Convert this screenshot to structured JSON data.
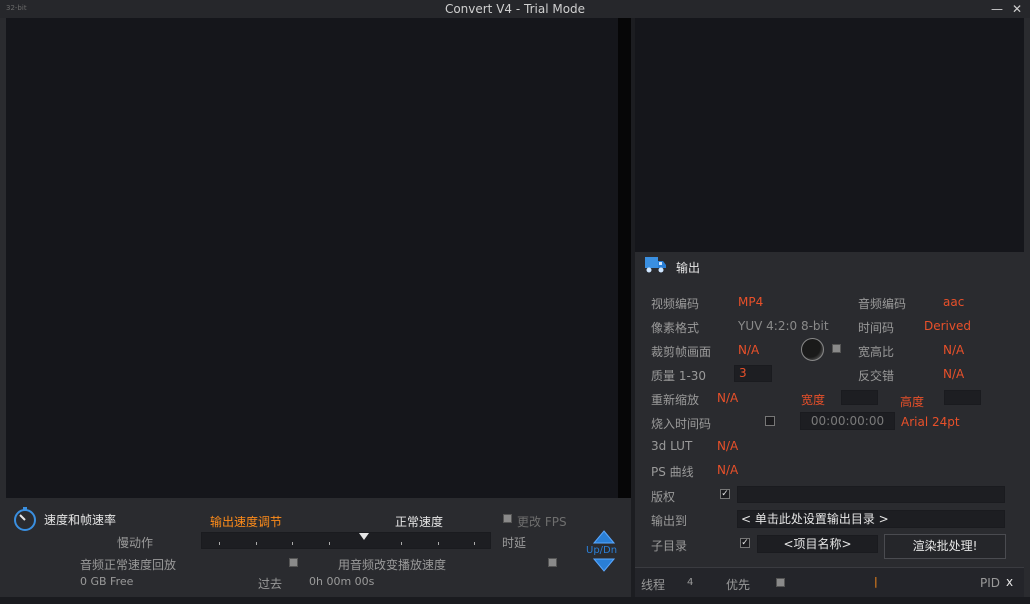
{
  "window": {
    "bitness": "32-bit",
    "title": "Convert V4 - Trial Mode",
    "minimize": "—",
    "close": "✕"
  },
  "output": {
    "section_title": "输出",
    "video_codec_label": "视频编码",
    "video_codec_value": "MP4",
    "audio_codec_label": "音频编码",
    "audio_codec_value": "aac",
    "pixel_format_label": "像素格式",
    "pixel_format_value": "YUV 4:2:0 8-bit",
    "timecode_label": "时间码",
    "timecode_value": "Derived",
    "crop_label": "裁剪帧画面",
    "crop_value": "N/A",
    "aspect_label": "宽高比",
    "aspect_value": "N/A",
    "quality_label": "质量 1-30",
    "quality_value": "3",
    "deinterlace_label": "反交错",
    "deinterlace_value": "N/A",
    "rescale_label": "重新缩放",
    "rescale_value": "N/A",
    "width_label": "宽度",
    "height_label": "高度",
    "burn_tc_label": "烧入时间码",
    "burn_tc_value": "00:00:00:00",
    "burn_tc_font": "Arial 24pt",
    "lut_label": "3d LUT",
    "lut_value": "N/A",
    "ps_curve_label": "PS 曲线",
    "ps_curve_value": "N/A",
    "copyright_label": "版权",
    "output_to_label": "输出到",
    "output_to_value": "< 单击此处设置输出目录 >",
    "subdir_label": "子目录",
    "subdir_value": "<项目名称>",
    "render_button": "渲染批处理!"
  },
  "status": {
    "threads_label": "线程",
    "threads_value": "4",
    "priority_label": "优先",
    "marker": "|",
    "pid_label": "PID",
    "close": "x"
  },
  "speed": {
    "section_title": "速度和帧速率",
    "slow_motion": "慢动作",
    "output_speed": "输出速度调节",
    "normal_speed": "正常速度",
    "change_fps": "更改 FPS",
    "delay": "时延",
    "audio_normal": "音频正常速度回放",
    "audio_change": "用音频改变播放速度",
    "free_space": "0 GB Free",
    "elapsed_label": "过去",
    "elapsed_value": "0h 00m 00s",
    "updn": "Up/Dn",
    "slider_position": 0.56
  },
  "colors": {
    "accent_red": "#e8502a",
    "accent_orange": "#ff8c1a",
    "arrow_blue": "#2a7fd6"
  }
}
